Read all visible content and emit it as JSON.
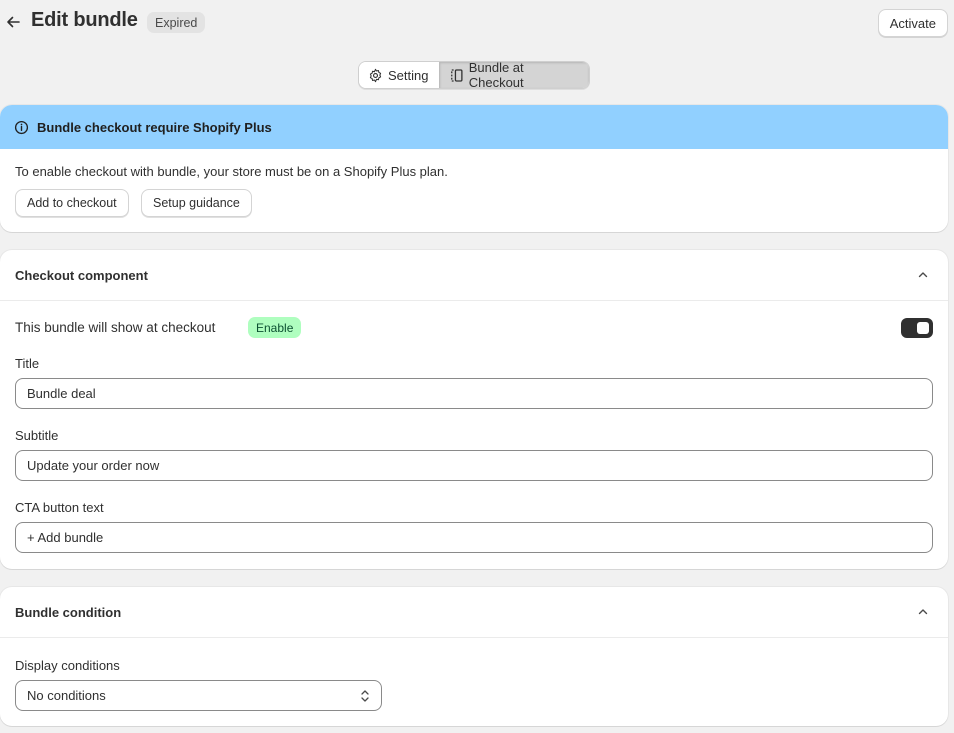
{
  "header": {
    "title": "Edit bundle",
    "status_badge": "Expired",
    "activate_label": "Activate"
  },
  "tabs": [
    {
      "label": "Setting",
      "icon": "gear-icon",
      "active": false
    },
    {
      "label": "Bundle at Checkout",
      "icon": "checkout-layout-icon",
      "active": true
    }
  ],
  "banner": {
    "title": "Bundle checkout require Shopify Plus",
    "icon": "info-icon",
    "color": "#91d0ff",
    "message": "To enable checkout with bundle, your store must be on a Shopify Plus plan.",
    "add_button": "Add to checkout",
    "guide_button": "Setup guidance"
  },
  "checkout_component": {
    "title": "Checkout component",
    "show_text": "This bundle will show at checkout",
    "status_badge": "Enable",
    "toggle_on": true,
    "fields": {
      "title_label": "Title",
      "title_value": "Bundle deal",
      "subtitle_label": "Subtitle",
      "subtitle_value": "Update your order now",
      "cta_label": "CTA button text",
      "cta_value": "+ Add bundle"
    }
  },
  "bundle_condition": {
    "title": "Bundle condition",
    "display_label": "Display conditions",
    "selected": "No conditions"
  }
}
